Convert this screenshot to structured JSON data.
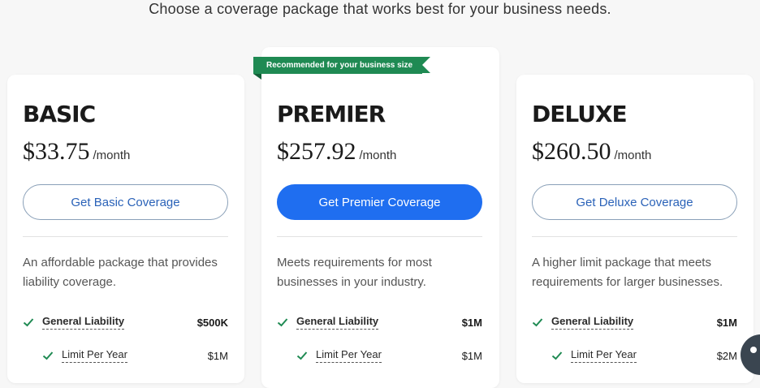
{
  "subtitle": "Choose a coverage package that works best for your business needs.",
  "ribbon": "Recommended for your business size",
  "colors": {
    "accent_blue": "#1f6ef0",
    "ribbon_green": "#1f8a53",
    "check_green": "#1f8a53"
  },
  "plans": [
    {
      "name": "BASIC",
      "price": "$33.75",
      "per": "/month",
      "button": "Get Basic Coverage",
      "description": "An affordable package that provides liability coverage.",
      "coverage": [
        {
          "label": "General Liability",
          "value": "$500K"
        },
        {
          "label": "Limit Per Year",
          "value": "$1M"
        }
      ]
    },
    {
      "name": "PREMIER",
      "price": "$257.92",
      "per": "/month",
      "button": "Get Premier Coverage",
      "description": "Meets requirements for most businesses in your industry.",
      "coverage": [
        {
          "label": "General Liability",
          "value": "$1M"
        },
        {
          "label": "Limit Per Year",
          "value": "$1M"
        }
      ]
    },
    {
      "name": "DELUXE",
      "price": "$260.50",
      "per": "/month",
      "button": "Get Deluxe Coverage",
      "description": "A higher limit package that meets requirements for larger businesses.",
      "coverage": [
        {
          "label": "General Liability",
          "value": "$1M"
        },
        {
          "label": "Limit Per Year",
          "value": "$2M"
        }
      ]
    }
  ],
  "icons": {
    "check": "checkmark-icon",
    "chat": "chat-icon"
  }
}
